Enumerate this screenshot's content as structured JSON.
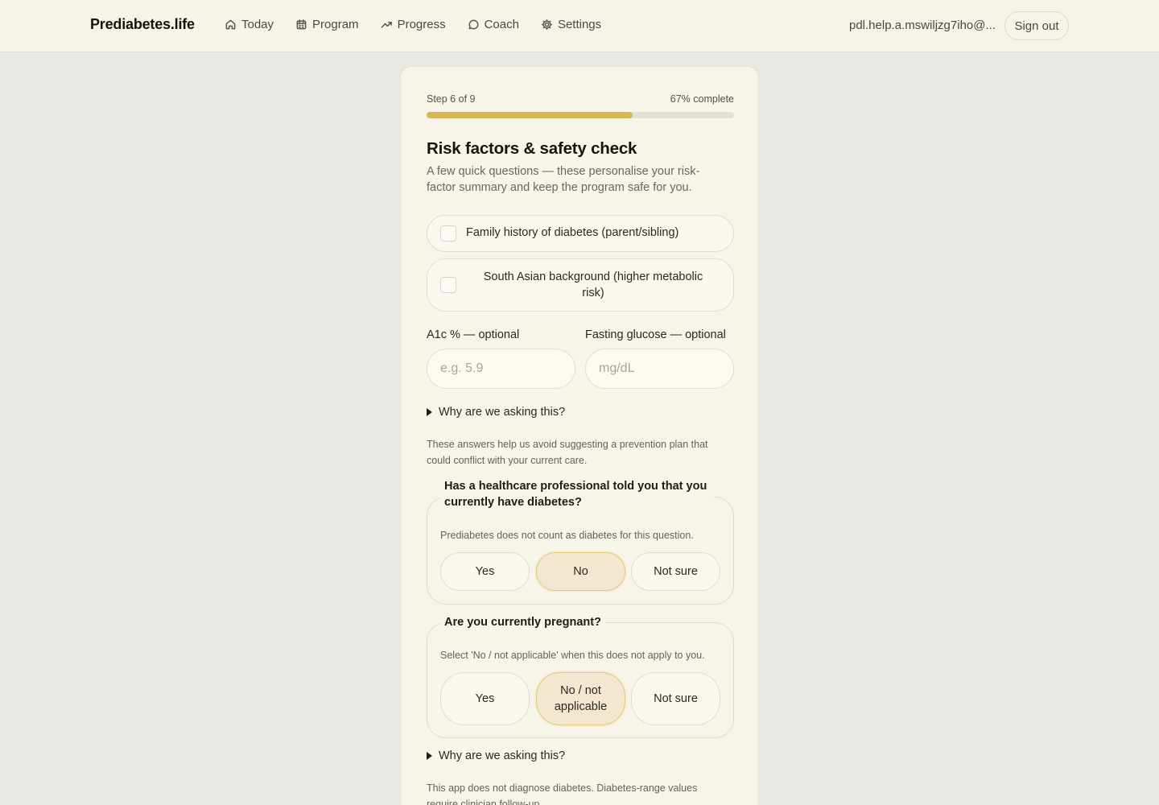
{
  "app": {
    "brand": "Prediabetes.life"
  },
  "nav": {
    "items": [
      {
        "label": "Today",
        "icon": "home-icon"
      },
      {
        "label": "Program",
        "icon": "calendar-icon"
      },
      {
        "label": "Progress",
        "icon": "trend-up-icon"
      },
      {
        "label": "Coach",
        "icon": "chat-bubble-icon"
      },
      {
        "label": "Settings",
        "icon": "gear-icon"
      }
    ],
    "user_email": "pdl.help.a.mswiljzg7iho@...",
    "sign_out": "Sign out"
  },
  "wizard": {
    "step_text": "Step 6 of 9",
    "complete_text": "67% complete",
    "progress_fraction": 0.67,
    "title": "Risk factors & safety check",
    "subtitle": "A few quick questions — these personalise your risk-factor summary and keep the program safe for you.",
    "checks": [
      {
        "label": "Family history of diabetes (parent/sibling)",
        "checked": false
      },
      {
        "label": "South Asian background (higher metabolic risk)",
        "checked": false
      }
    ],
    "a1c": {
      "label": "A1c % — optional",
      "placeholder": "e.g. 5.9"
    },
    "glucose": {
      "label": "Fasting glucose — optional",
      "placeholder": "mg/dL"
    },
    "why_label": "Why are we asking this?",
    "note1": "These answers help us avoid suggesting a prevention plan that could conflict with your current care.",
    "q1": {
      "question": "Has a healthcare professional told you that you currently have diabetes?",
      "hint": "Prediabetes does not count as diabetes for this question.",
      "options": [
        "Yes",
        "No",
        "Not sure"
      ],
      "selected": "No"
    },
    "q2": {
      "question": "Are you currently pregnant?",
      "hint": "Select 'No / not applicable' when this does not apply to you.",
      "options": [
        "Yes",
        "No / not applicable",
        "Not sure"
      ],
      "selected": "No / not applicable"
    },
    "why_label_2": "Why are we asking this?",
    "note2": "This app does not diagnose diabetes. Diabetes-range values require clinician follow-up."
  },
  "colors": {
    "accent": "#d9b755",
    "selected_bg": "#f3e8cf",
    "page_bg": "#e8e9e4",
    "card_bg": "#f7f4ea"
  }
}
